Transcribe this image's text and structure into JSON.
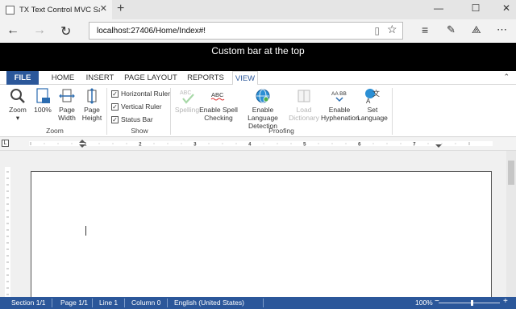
{
  "browser": {
    "tab_title": "TX Text Control MVC Sa",
    "url": "localhost:27406/Home/Index#!"
  },
  "custom_bar": "Custom bar at the top",
  "ribbon_tabs": [
    "FILE",
    "HOME",
    "INSERT",
    "PAGE LAYOUT",
    "REPORTS",
    "VIEW"
  ],
  "active_tab": "VIEW",
  "groups": {
    "zoom": {
      "label": "Zoom",
      "zoom": "Zoom",
      "pct": "100%",
      "page_width_1": "Page",
      "page_width_2": "Width",
      "page_height_1": "Page",
      "page_height_2": "Height"
    },
    "show": {
      "label": "Show",
      "horizontal_ruler": "Horizontal Ruler",
      "vertical_ruler": "Vertical Ruler",
      "status_bar": "Status Bar"
    },
    "proofing": {
      "label": "Proofing",
      "spelling": "Spelling",
      "spelling_icon_text": "ABC",
      "enable_spell_1": "Enable Spell",
      "enable_spell_2": "Checking",
      "enable_spell_icon_text": "ABC",
      "enable_lang_1": "Enable Language",
      "enable_lang_2": "Detection",
      "load_dict_1": "Load",
      "load_dict_2": "Dictionary",
      "enable_hyph_1": "Enable",
      "enable_hyph_2": "Hyphenation",
      "hyph_icon_text": "AA BB",
      "set_lang_1": "Set",
      "set_lang_2": "Language",
      "set_lang_glyph": "文",
      "set_lang_a": "A"
    }
  },
  "checks": {
    "horizontal_ruler": true,
    "vertical_ruler": true,
    "status_bar": true
  },
  "ruler_numbers": [
    "1",
    "2",
    "3",
    "4",
    "5",
    "6",
    "7"
  ],
  "status": {
    "section": "Section 1/1",
    "page": "Page 1/1",
    "line": "Line 1",
    "column": "Column 0",
    "language": "English (United States)",
    "zoom": "100%"
  },
  "colors": {
    "accent": "#2b579a",
    "custom_bar_bg": "#000000"
  },
  "icons": {
    "back": "arrow-left-icon",
    "forward": "arrow-right-icon",
    "refresh": "refresh-icon",
    "reading": "reading-view-icon",
    "favorite": "star-icon",
    "hub": "hub-icon",
    "note": "web-note-icon",
    "share": "share-icon",
    "more": "more-icon"
  }
}
